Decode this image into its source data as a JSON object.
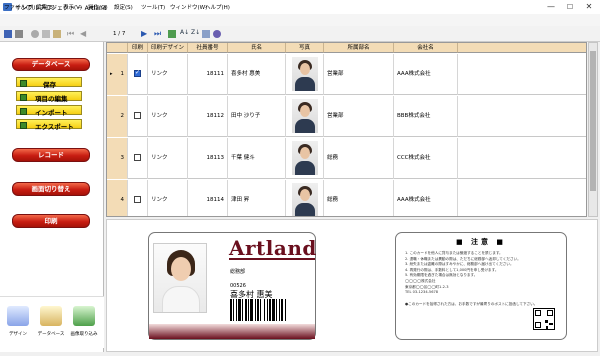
{
  "window": {
    "title": "サンプルプロジェクト － Artland",
    "controls": [
      "—",
      "☐",
      "✕"
    ]
  },
  "menu": [
    "ファイル(F)",
    "編集(E)",
    "表示(V)",
    "操作(O)",
    "設定(S)",
    "ツール(T)",
    "ウィンドウ(W)",
    "ヘルプ(H)"
  ],
  "toolbar": {
    "page_counter": "1 / 7",
    "icons": [
      "save-icon",
      "print-icon",
      "cut-icon",
      "copy-icon",
      "paste-icon",
      "first-record-icon",
      "prev-record-icon",
      "next-record-icon",
      "last-record-icon",
      "image-icon",
      "sort-asc-icon",
      "sort-desc-icon",
      "table-icon",
      "settings-icon"
    ]
  },
  "sidebar": {
    "database_button": "データベース",
    "sub_buttons": [
      "保存",
      "項目の編集",
      "インポート",
      "エクスポート"
    ],
    "record_button": "レコード",
    "screen_switch_button": "画面切り替え",
    "print_button": "印刷",
    "tools": [
      "デザイン",
      "データベース",
      "画像取り込み"
    ]
  },
  "grid": {
    "columns": [
      "印刷",
      "印刷デザイン",
      "社員番号",
      "氏名",
      "写真",
      "所属部名",
      "会社名"
    ],
    "rows": [
      {
        "num": "1",
        "checked": true,
        "design": "リンク",
        "emp_no": "18111",
        "name": "喜多村 惠美",
        "dept": "営業部",
        "company": "AAA株式会社"
      },
      {
        "num": "2",
        "checked": false,
        "design": "リンク",
        "emp_no": "18112",
        "name": "田中 沙り子",
        "dept": "営業部",
        "company": "BBB株式会社"
      },
      {
        "num": "3",
        "checked": false,
        "design": "リンク",
        "emp_no": "18113",
        "name": "千葉 健斗",
        "dept": "総務",
        "company": "CCC株式会社"
      },
      {
        "num": "4",
        "checked": false,
        "design": "リンク",
        "emp_no": "18114",
        "name": "津田 昇",
        "dept": "総務",
        "company": "AAA株式会社"
      }
    ]
  },
  "card_front": {
    "brand": "Artland",
    "dept": "総務部",
    "emp_no": "00526",
    "name": "喜多村 惠美"
  },
  "card_back": {
    "title": "■ 注意 ■",
    "lines": [
      "1. このカードを他人に貸与または譲渡することを禁じます。",
      "2. 退職・休職または異動の際は、ただちに総務部へ返却してください。",
      "3. 紛失または盗難の際はすみやかに、総務部へ届け出てください。",
      "4. 再発行の際は、手数料として1,000円を申し受けます。",
      "5. 有効期限を過ぎた場合は無効となります。",
      "◯◯◯◯株式会社",
      "東京都◯◯区◯◯町1-2-3",
      "TEL 03-1234-5678",
      "●このカードを拾得された方は、お手数ですが最寄りのポストに投函して下さい。"
    ]
  },
  "colors": {
    "header_bg": "#f3dcb6",
    "red_button": "#c81d12",
    "yellow_button": "#f6cf14",
    "brand": "#6a0f1e"
  }
}
